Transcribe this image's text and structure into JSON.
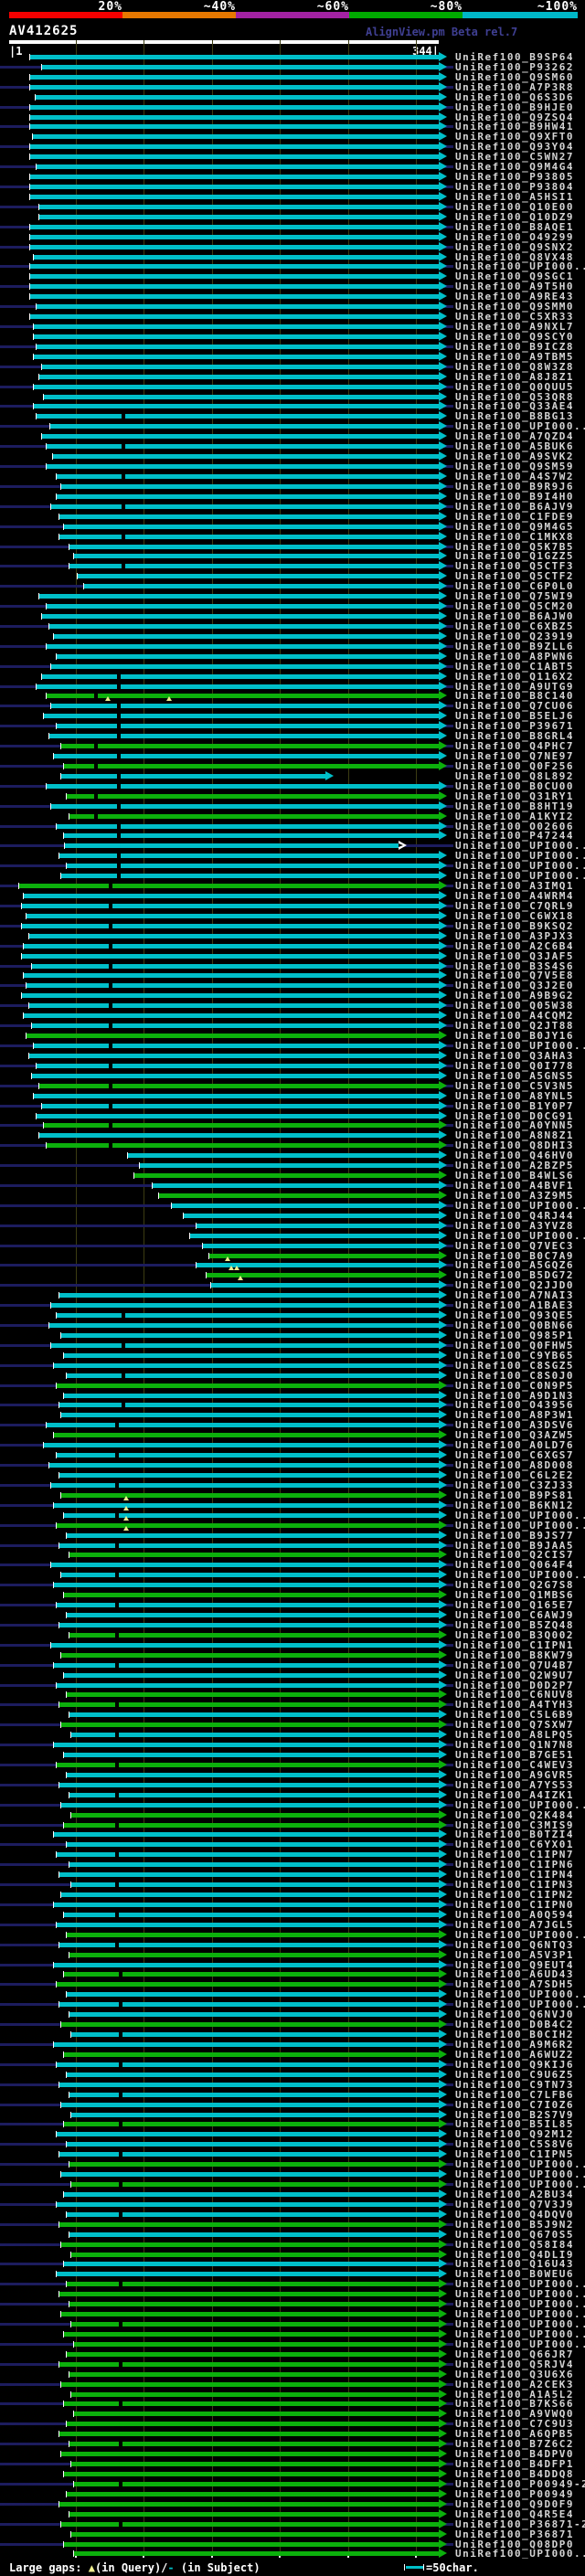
{
  "header": {
    "key": {
      "segments": [
        {
          "label": "20%",
          "color": "#f50000"
        },
        {
          "label": "~40%",
          "color": "#e67800"
        },
        {
          "label": "~60%",
          "color": "#a322a3"
        },
        {
          "label": "~80%",
          "color": "#00aa00"
        },
        {
          "label": "~100%",
          "color": "#00b8c8"
        }
      ]
    },
    "query_name": "AV412625",
    "watermark": "AlignView.pm Beta rel.7",
    "ruler": {
      "start_label": "|1",
      "end_label": "344|"
    }
  },
  "colors": {
    "cyan": "#00bfc9",
    "green": "#0cb00c",
    "navy": "#1c1c5e",
    "grid": "#3c3c12",
    "label": "#d4d4d4",
    "triangle": "#f0f090",
    "white": "#ffffff",
    "watermark": "#3f3f92"
  },
  "legend": {
    "prefix": "Large gaps: ",
    "triangle_icon": "▲",
    "query_text": "(in Query)/",
    "subject_dash": "-",
    "subject_text": " (in Subject)",
    "scale_sample_label": "=50char."
  },
  "chart_data": {
    "type": "alignment-hit-map",
    "query_name": "AV412625",
    "query_length": 344,
    "label_prefix": "UniRef100_",
    "hit_format": [
      "accession",
      "bar_color(c=cyan,g=green)",
      "align_start_pos",
      "gap_positions(optional)"
    ],
    "hits": [
      [
        "B9SP64",
        "c",
        17
      ],
      [
        "P93262",
        "c",
        26
      ],
      [
        "Q9SM60",
        "c",
        17
      ],
      [
        "A7P3R8",
        "c",
        17
      ],
      [
        "Q6S3D6",
        "c",
        21
      ],
      [
        "B9HJE0",
        "c",
        17
      ],
      [
        "Q9ZSQ4",
        "c",
        17
      ],
      [
        "B9HW41",
        "c",
        17
      ],
      [
        "Q9XFT0",
        "c",
        19
      ],
      [
        "Q93Y04",
        "c",
        17
      ],
      [
        "C5WN27",
        "c",
        17
      ],
      [
        "Q9M4G4",
        "c",
        22
      ],
      [
        "P93805",
        "c",
        17
      ],
      [
        "P93804",
        "c",
        17
      ],
      [
        "A5HSI1",
        "c",
        17
      ],
      [
        "Q10E00",
        "c",
        24
      ],
      [
        "Q10DZ9",
        "c",
        24
      ],
      [
        "B8AQE1",
        "c",
        17
      ],
      [
        "O49299",
        "c",
        17
      ],
      [
        "Q9SNX2",
        "c",
        17
      ],
      [
        "Q8VX48",
        "c",
        20
      ],
      [
        "UPI000..",
        "c",
        17
      ],
      [
        "Q9SGC1",
        "c",
        17
      ],
      [
        "A9T5H0",
        "c",
        17
      ],
      [
        "A9RE43",
        "c",
        17
      ],
      [
        "Q9SMM0",
        "c",
        22
      ],
      [
        "C5XR33",
        "c",
        17
      ],
      [
        "A9NXL7",
        "c",
        20
      ],
      [
        "Q9SCY0",
        "c",
        20
      ],
      [
        "B9ICZ8",
        "c",
        22
      ],
      [
        "A9TBM5",
        "c",
        20
      ],
      [
        "Q8W3Z8",
        "c",
        26
      ],
      [
        "A8J8Z1",
        "c",
        24
      ],
      [
        "Q0QUU5",
        "c",
        20
      ],
      [
        "Q53QR8",
        "c",
        28
      ],
      [
        "Q33AE4",
        "c",
        20
      ],
      [
        "B8BG13",
        "c",
        22,
        [
          90
        ]
      ],
      [
        "UPI000..",
        "c",
        33
      ],
      [
        "A7QZD4",
        "c",
        26
      ],
      [
        "A5BUK6",
        "c",
        30,
        [
          90
        ]
      ],
      [
        "A9SVK2",
        "c",
        35
      ],
      [
        "Q9SM59",
        "c",
        30
      ],
      [
        "A4S7W2",
        "c",
        38,
        [
          90
        ]
      ],
      [
        "B9R9J6",
        "c",
        42
      ],
      [
        "B9I4H0",
        "c",
        38
      ],
      [
        "B6AJV9",
        "c",
        34,
        [
          90
        ]
      ],
      [
        "C1FDE9",
        "c",
        40
      ],
      [
        "Q9M4G5",
        "c",
        44
      ],
      [
        "C1MKX8",
        "c",
        40,
        [
          90
        ]
      ],
      [
        "Q5K7B5",
        "c",
        48
      ],
      [
        "Q1GZZ5",
        "c",
        52
      ],
      [
        "Q5CTF3",
        "c",
        48,
        [
          90
        ]
      ],
      [
        "Q5CTF2",
        "c",
        55
      ],
      [
        "C6P0L0",
        "c",
        60
      ],
      [
        "Q75WI9",
        "c",
        24
      ],
      [
        "Q5CM20",
        "c",
        30
      ],
      [
        "B6AJW0",
        "c",
        26
      ],
      [
        "C6XBZ5",
        "c",
        32
      ],
      [
        "Q23919",
        "c",
        36
      ],
      [
        "B9ZLL6",
        "c",
        30
      ],
      [
        "A8PWN6",
        "c",
        38
      ],
      [
        "C1ABT5",
        "c",
        34
      ],
      [
        "Q116X2",
        "c",
        26,
        [
          86
        ]
      ],
      [
        "A9UTG9",
        "c",
        22,
        [
          86
        ]
      ],
      [
        "B8C140",
        "g",
        30,
        [
          68
        ]
      ],
      [
        "Q7CU06",
        "c",
        34,
        [
          86
        ]
      ],
      [
        "B5ELJ6",
        "c",
        28,
        [
          86
        ]
      ],
      [
        "P39671",
        "c",
        38,
        [
          86
        ]
      ],
      [
        "B8GRL4",
        "c",
        32,
        [
          86
        ]
      ],
      [
        "Q4PHC7",
        "g",
        42,
        [
          68
        ]
      ],
      [
        "Q7NE97",
        "c",
        36,
        [
          86
        ]
      ],
      [
        "Q0F256",
        "g",
        44,
        [
          68
        ]
      ],
      [
        "Q8L892",
        "c",
        42,
        [
          86
        ]
      ],
      [
        "B0CU00",
        "c",
        30,
        [
          86
        ]
      ],
      [
        "Q31RY1",
        "g",
        46,
        [
          68
        ]
      ],
      [
        "B8HT19",
        "c",
        34,
        [
          86
        ]
      ],
      [
        "A1KYI2",
        "g",
        48,
        [
          68
        ]
      ],
      [
        "O02606",
        "c",
        38,
        [
          86
        ]
      ],
      [
        "P47244",
        "c",
        44,
        [
          86
        ]
      ],
      [
        "UPI000..",
        "c",
        45
      ],
      [
        "UPI000..",
        "c",
        40,
        [
          86
        ]
      ],
      [
        "UPI000..",
        "c",
        46,
        [
          86
        ]
      ],
      [
        "UPI000..",
        "c",
        42,
        [
          86
        ]
      ],
      [
        "A3IMQ1",
        "g",
        8,
        [
          80
        ]
      ],
      [
        "A4WRM4",
        "c",
        12
      ],
      [
        "C7QRL9",
        "c",
        10,
        [
          80
        ]
      ],
      [
        "C6WX18",
        "c",
        14
      ],
      [
        "B9KSQ2",
        "c",
        10,
        [
          80
        ]
      ],
      [
        "A3PJX3",
        "c",
        16
      ],
      [
        "A2C6B4",
        "c",
        12,
        [
          80
        ]
      ],
      [
        "Q3JAF5",
        "c",
        10
      ],
      [
        "B3S4S6",
        "c",
        18,
        [
          80
        ]
      ],
      [
        "Q7V5E8",
        "c",
        12
      ],
      [
        "Q3J2E0",
        "c",
        14,
        [
          80
        ]
      ],
      [
        "A9B9G2",
        "c",
        10
      ],
      [
        "Q05W38",
        "c",
        16,
        [
          80
        ]
      ],
      [
        "A4CQM2",
        "c",
        12
      ],
      [
        "Q2JT88",
        "c",
        18,
        [
          80
        ]
      ],
      [
        "B0JY16",
        "g",
        14
      ],
      [
        "UPI000..",
        "c",
        20,
        [
          80
        ]
      ],
      [
        "Q3AHA3",
        "c",
        16
      ],
      [
        "Q0I778",
        "c",
        22,
        [
          80
        ]
      ],
      [
        "A5GNS5",
        "c",
        18
      ],
      [
        "C5V3N5",
        "g",
        24,
        [
          80
        ]
      ],
      [
        "A8YNL5",
        "c",
        20
      ],
      [
        "B1Y0P7",
        "c",
        26,
        [
          80
        ]
      ],
      [
        "D0CG91",
        "c",
        22
      ],
      [
        "A0YNN5",
        "g",
        28,
        [
          80
        ]
      ],
      [
        "A8N8Z1",
        "c",
        24
      ],
      [
        "Q8DHI3",
        "g",
        30,
        [
          80
        ]
      ],
      [
        "Q46HV0",
        "c",
        95
      ],
      [
        "A2BZP5",
        "c",
        105
      ],
      [
        "B4WLS6",
        "g",
        100
      ],
      [
        "A4BVF1",
        "c",
        115
      ],
      [
        "A3Z9M5",
        "g",
        120
      ],
      [
        "UPI000..",
        "c",
        130
      ],
      [
        "Q4RJ44",
        "c",
        140
      ],
      [
        "A3YVZ8",
        "c",
        150
      ],
      [
        "UPI000..",
        "c",
        145
      ],
      [
        "Q7VEC3",
        "c",
        155
      ],
      [
        "B0C7A9",
        "g",
        160
      ],
      [
        "A5GQZ6",
        "c",
        150
      ],
      [
        "B5DG72",
        "g",
        158
      ],
      [
        "Q2JJD0",
        "c",
        162
      ],
      [
        "A7NAI3",
        "c",
        40
      ],
      [
        "A1BAE3",
        "c",
        34
      ],
      [
        "Q93QE5",
        "c",
        38,
        [
          90
        ]
      ],
      [
        "Q0BN66",
        "c",
        32
      ],
      [
        "Q985P1",
        "c",
        42
      ],
      [
        "Q0FHW5",
        "c",
        34,
        [
          90
        ]
      ],
      [
        "C9YB65",
        "c",
        44
      ],
      [
        "C8SGZ5",
        "c",
        36
      ],
      [
        "C8S0J0",
        "c",
        46,
        [
          90
        ]
      ],
      [
        "C0N9P5",
        "g",
        38
      ],
      [
        "A9D1N3",
        "c",
        44
      ],
      [
        "O43956",
        "c",
        40,
        [
          90
        ]
      ],
      [
        "A8P3W1",
        "c",
        42
      ],
      [
        "A3DSV6",
        "c",
        30,
        [
          85
        ]
      ],
      [
        "Q3AZW5",
        "g",
        36
      ],
      [
        "A0LD76",
        "c",
        28
      ],
      [
        "C6XGS7",
        "c",
        38,
        [
          85
        ]
      ],
      [
        "A8D008",
        "c",
        32
      ],
      [
        "C6L2E2",
        "c",
        40
      ],
      [
        "C3ZJ33",
        "c",
        34,
        [
          85
        ]
      ],
      [
        "B9PS81",
        "g",
        42
      ],
      [
        "B6KN12",
        "c",
        36
      ],
      [
        "UPI000..",
        "c",
        44,
        [
          85
        ]
      ],
      [
        "UPI000..",
        "g",
        38
      ],
      [
        "B9JS77",
        "c",
        46
      ],
      [
        "B9JAA5",
        "c",
        40,
        [
          85
        ]
      ],
      [
        "Q2CIS7",
        "g",
        48
      ],
      [
        "Q064F4",
        "c",
        34
      ],
      [
        "UPI000..",
        "c",
        42,
        [
          85
        ]
      ],
      [
        "Q2G7S8",
        "c",
        36
      ],
      [
        "Q1MBS6",
        "g",
        44
      ],
      [
        "Q165E7",
        "c",
        38,
        [
          85
        ]
      ],
      [
        "C6AWJ9",
        "c",
        46
      ],
      [
        "B5ZQ48",
        "c",
        40
      ],
      [
        "B3Q002",
        "g",
        48,
        [
          85
        ]
      ],
      [
        "C1IPN1",
        "c",
        34
      ],
      [
        "B8KW79",
        "g",
        42
      ],
      [
        "Q7U4B7",
        "c",
        36,
        [
          85
        ]
      ],
      [
        "Q2W9U7",
        "c",
        44
      ],
      [
        "D0D2P7",
        "c",
        38
      ],
      [
        "C6NUV8",
        "g",
        46
      ],
      [
        "A4TYH3",
        "g",
        40,
        [
          85
        ]
      ],
      [
        "C5L6B9",
        "c",
        48
      ],
      [
        "Q7SXW7",
        "g",
        42
      ],
      [
        "A8LPQ5",
        "c",
        50,
        [
          85
        ]
      ],
      [
        "Q1N7N8",
        "c",
        36
      ],
      [
        "B7GE51",
        "c",
        44
      ],
      [
        "C4WEV3",
        "g",
        38,
        [
          85
        ]
      ],
      [
        "A9GVR5",
        "c",
        46
      ],
      [
        "A7YS53",
        "c",
        40
      ],
      [
        "A4IZK1",
        "c",
        48,
        [
          85
        ]
      ],
      [
        "UPI000..",
        "c",
        42
      ],
      [
        "Q2K484",
        "g",
        50
      ],
      [
        "C3MIS9",
        "g",
        44,
        [
          85
        ]
      ],
      [
        "B0TZI4",
        "c",
        36
      ],
      [
        "C6YX01",
        "c",
        46
      ],
      [
        "C1IPN7",
        "c",
        38,
        [
          85
        ]
      ],
      [
        "C1IPN6",
        "c",
        48
      ],
      [
        "C1IPN4",
        "c",
        40
      ],
      [
        "C1IPN3",
        "c",
        50,
        [
          85
        ]
      ],
      [
        "C1IPN2",
        "c",
        42
      ],
      [
        "C1IPN0",
        "c",
        36
      ],
      [
        "A0Q594",
        "c",
        44,
        [
          85
        ]
      ],
      [
        "A7JGL5",
        "c",
        38
      ],
      [
        "UPI000..",
        "g",
        46
      ],
      [
        "Q6NTQ3",
        "c",
        40,
        [
          85
        ]
      ],
      [
        "A5V3P1",
        "g",
        48
      ],
      [
        "Q9EUT4",
        "c",
        36
      ],
      [
        "A6UD43",
        "g",
        44,
        [
          88
        ]
      ],
      [
        "A7SDH5",
        "g",
        38
      ],
      [
        "UPI000..",
        "c",
        46
      ],
      [
        "UPI000..",
        "c",
        40,
        [
          88
        ]
      ],
      [
        "Q6NVJ0",
        "c",
        48
      ],
      [
        "D0B4C2",
        "g",
        42
      ],
      [
        "B0CIH2",
        "c",
        50,
        [
          88
        ]
      ],
      [
        "A9M6R2",
        "c",
        36
      ],
      [
        "A6WUZ2",
        "g",
        44
      ],
      [
        "Q9KIJ6",
        "c",
        38,
        [
          88
        ]
      ],
      [
        "C9U6Z5",
        "c",
        46
      ],
      [
        "C9TN73",
        "c",
        40
      ],
      [
        "C7LFB6",
        "c",
        48,
        [
          88
        ]
      ],
      [
        "C7I0Z6",
        "c",
        42
      ],
      [
        "B2S7V9",
        "c",
        50
      ],
      [
        "B5IL85",
        "g",
        44,
        [
          88
        ]
      ],
      [
        "Q92M12",
        "c",
        38
      ],
      [
        "C5S8V6",
        "c",
        46
      ],
      [
        "C1IPN5",
        "c",
        40,
        [
          88
        ]
      ],
      [
        "UPI000..",
        "g",
        48
      ],
      [
        "UPI000..",
        "c",
        42
      ],
      [
        "UPI000..",
        "g",
        50,
        [
          88
        ]
      ],
      [
        "A2BU34",
        "c",
        44
      ],
      [
        "Q7V3J9",
        "c",
        38
      ],
      [
        "Q4DQV0",
        "c",
        46,
        [
          88
        ]
      ],
      [
        "B5J9N2",
        "g",
        40
      ],
      [
        "Q670S5",
        "c",
        48
      ],
      [
        "Q58I84",
        "g",
        42
      ],
      [
        "Q4DLI9",
        "g",
        50
      ],
      [
        "Q16U43",
        "c",
        44
      ],
      [
        "B0WEU6",
        "c",
        38
      ],
      [
        "UPI000..",
        "g",
        46,
        [
          88
        ]
      ],
      [
        "UPI000..",
        "g",
        40
      ],
      [
        "UPI000..",
        "g",
        48
      ],
      [
        "UPI000..",
        "g",
        42
      ],
      [
        "UPI000..",
        "g",
        50,
        [
          88
        ]
      ],
      [
        "UPI000..",
        "g",
        44
      ],
      [
        "UPI000..",
        "g",
        52
      ],
      [
        "Q66JR7",
        "g",
        46
      ],
      [
        "Q5RJV4",
        "g",
        40,
        [
          88
        ]
      ],
      [
        "Q3U6X6",
        "g",
        48
      ],
      [
        "A2CEK3",
        "g",
        42
      ],
      [
        "A1A5L2",
        "g",
        50
      ],
      [
        "B7KS66",
        "g",
        44,
        [
          88
        ]
      ],
      [
        "A9VWQ0",
        "g",
        52
      ],
      [
        "C7C9U3",
        "g",
        46
      ],
      [
        "A6QPB5",
        "g",
        40
      ],
      [
        "B7Z6C2",
        "g",
        48,
        [
          88
        ]
      ],
      [
        "B4DPV0",
        "g",
        42
      ],
      [
        "B4DFP1",
        "g",
        50
      ],
      [
        "B4DDQ8",
        "g",
        44
      ],
      [
        "P00949-2",
        "g",
        52,
        [
          88
        ]
      ],
      [
        "P00949",
        "g",
        46
      ],
      [
        "Q9D0F9",
        "g",
        40
      ],
      [
        "Q4R5E4",
        "g",
        48
      ],
      [
        "P36871-2",
        "g",
        42,
        [
          88
        ]
      ],
      [
        "P36871",
        "g",
        50
      ],
      [
        "Q08DP0",
        "g",
        44
      ],
      [
        "UPI000..",
        "g",
        52
      ]
    ],
    "row_overrides": {
      "73": {
        "end": 253
      },
      "80": {
        "end": 312,
        "open_arrow": true
      },
      "65": {
        "tris": [
          79,
          128
        ]
      },
      "121": {
        "tris": [
          175
        ]
      },
      "122": {
        "tris": [
          178,
          182
        ]
      },
      "123": {
        "tris": [
          185
        ]
      },
      "145": {
        "tris": [
          94
        ]
      },
      "146": {
        "tris": [
          94
        ]
      },
      "147": {
        "tris": [
          94
        ]
      },
      "148": {
        "tris": [
          94
        ]
      }
    }
  }
}
